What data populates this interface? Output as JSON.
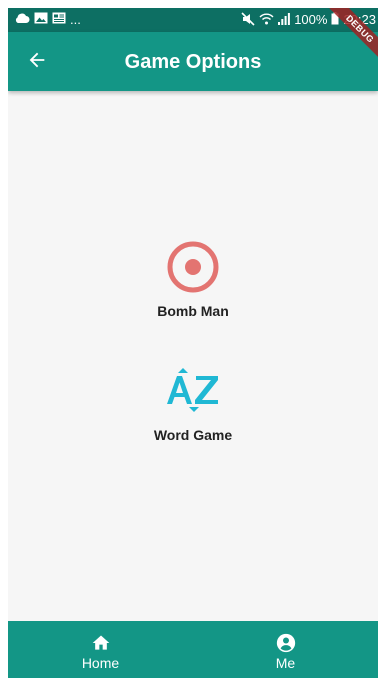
{
  "status_bar": {
    "left_ellipsis": "...",
    "battery": "100%",
    "time": "20:23",
    "icons": [
      "cloud-icon",
      "image-icon",
      "news-icon",
      "mute-icon",
      "wifi-icon",
      "signal-icon",
      "battery-icon"
    ]
  },
  "app_bar": {
    "title": "Game Options",
    "back_icon": "arrow-left-icon",
    "debug_banner": "DEBUG"
  },
  "options": [
    {
      "label": "Bomb Man",
      "icon": "target-icon",
      "color": "#e37471"
    },
    {
      "label": "Word Game",
      "icon": "az-sort-icon",
      "color": "#20b8d4"
    }
  ],
  "bottom_nav": {
    "items": [
      {
        "label": "Home",
        "icon": "home-icon"
      },
      {
        "label": "Me",
        "icon": "account-circle-icon"
      }
    ]
  },
  "colors": {
    "primary": "#139686",
    "status_bar": "#0d6f63",
    "background": "#f6f6f6"
  }
}
